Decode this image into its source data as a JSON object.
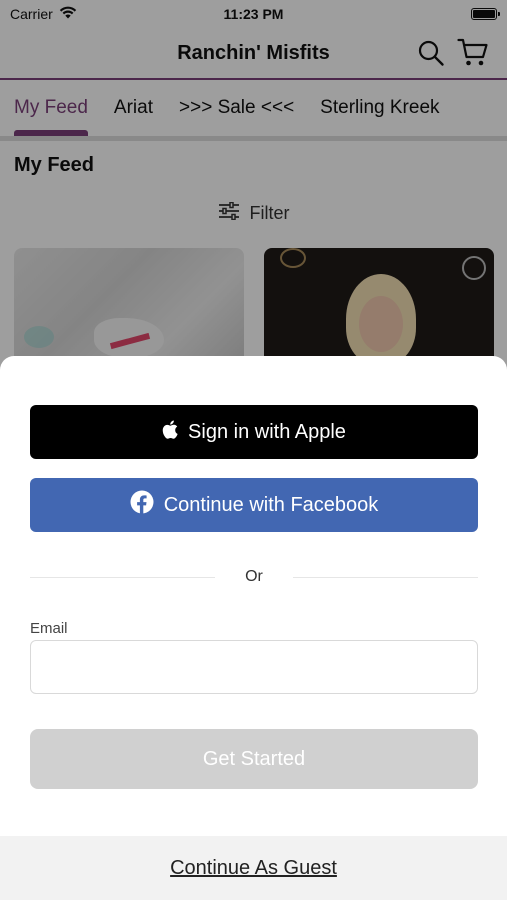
{
  "status_bar": {
    "carrier": "Carrier",
    "time": "11:23 PM"
  },
  "header": {
    "title": "Ranchin' Misfits",
    "icons": [
      "search-icon",
      "cart-icon"
    ],
    "accent_color": "#7b3f7a"
  },
  "tabs": [
    {
      "label": "My Feed",
      "active": true
    },
    {
      "label": "Ariat",
      "active": false
    },
    {
      "label": ">>> Sale <<<",
      "active": false
    },
    {
      "label": "Sterling Kreek",
      "active": false
    }
  ],
  "feed": {
    "title": "My Feed",
    "filter_label": "Filter"
  },
  "sheet": {
    "apple_button": "Sign in with Apple",
    "facebook_button": "Continue with Facebook",
    "or_label": "Or",
    "email_label": "Email",
    "email_value": "",
    "get_started_button": "Get Started",
    "guest_link": "Continue As Guest",
    "colors": {
      "apple": "#000000",
      "facebook": "#4267b2",
      "disabled": "#d0d0d0"
    }
  }
}
